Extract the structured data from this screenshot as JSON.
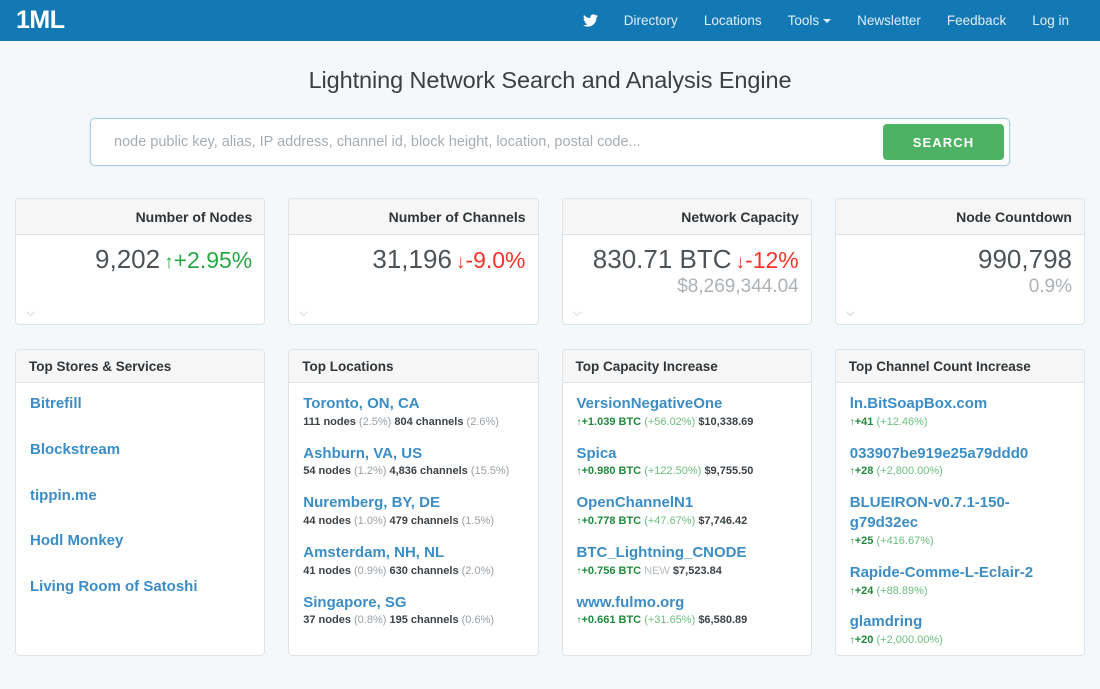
{
  "navbar": {
    "brand": "1ML",
    "twitter_icon": "twitter-icon",
    "links": [
      {
        "label": "Directory",
        "name": "directory"
      },
      {
        "label": "Locations",
        "name": "locations"
      },
      {
        "label": "Tools",
        "name": "tools",
        "caret": true
      },
      {
        "label": "Newsletter",
        "name": "newsletter"
      },
      {
        "label": "Feedback",
        "name": "feedback"
      },
      {
        "label": "Log in",
        "name": "login"
      }
    ]
  },
  "hero": {
    "title": "Lightning Network Search and Analysis Engine",
    "search_placeholder": "node public key, alias, IP address, channel id, block height, location, postal code...",
    "search_value": "",
    "search_button": "SEARCH"
  },
  "colors": {
    "navbar_blue": "#1279b5",
    "search_green": "#4eb264",
    "link_blue": "#3c8dc5",
    "up_green": "#29a745",
    "down_red": "#f6342a",
    "page_bg": "#f4f8fb"
  },
  "stats": [
    {
      "title": "Number of Nodes",
      "value": "9,202",
      "delta": "+2.95%",
      "direction": "up",
      "arrow": "↑",
      "sub": "",
      "chevron": "chevron-down-icon"
    },
    {
      "title": "Number of Channels",
      "value": "31,196",
      "delta": "-9.0%",
      "direction": "down",
      "arrow": "↓",
      "sub": "",
      "chevron": "chevron-down-icon"
    },
    {
      "title": "Network Capacity",
      "value": "830.71 BTC",
      "delta": "-12%",
      "direction": "down",
      "arrow": "↓",
      "sub": "$8,269,344.04",
      "chevron": "chevron-down-icon"
    },
    {
      "title": "Node Countdown",
      "value": "990,798",
      "delta": "",
      "direction": "none",
      "arrow": "",
      "sub": "0.9%",
      "chevron": "chevron-down-icon"
    }
  ],
  "panels": {
    "stores": {
      "title": "Top Stores & Services",
      "items": [
        {
          "name": "Bitrefill"
        },
        {
          "name": "Blockstream"
        },
        {
          "name": "tippin.me"
        },
        {
          "name": "Hodl Monkey"
        },
        {
          "name": "Living Room of Satoshi"
        }
      ]
    },
    "locations": {
      "title": "Top Locations",
      "items": [
        {
          "name": "Toronto, ON, CA",
          "nodes": "111 nodes",
          "nodes_pct": "(2.5%)",
          "channels": "804 channels",
          "channels_pct": "(2.6%)"
        },
        {
          "name": "Ashburn, VA, US",
          "nodes": "54 nodes",
          "nodes_pct": "(1.2%)",
          "channels": "4,836 channels",
          "channels_pct": "(15.5%)"
        },
        {
          "name": "Nuremberg, BY, DE",
          "nodes": "44 nodes",
          "nodes_pct": "(1.0%)",
          "channels": "479 channels",
          "channels_pct": "(1.5%)"
        },
        {
          "name": "Amsterdam, NH, NL",
          "nodes": "41 nodes",
          "nodes_pct": "(0.9%)",
          "channels": "630 channels",
          "channels_pct": "(2.0%)"
        },
        {
          "name": "Singapore, SG",
          "nodes": "37 nodes",
          "nodes_pct": "(0.8%)",
          "channels": "195 channels",
          "channels_pct": "(0.6%)"
        }
      ]
    },
    "capacity": {
      "title": "Top Capacity Increase",
      "items": [
        {
          "name": "VersionNegativeOne",
          "arrow": "↑",
          "amount": "+1.039 BTC",
          "pct": "(+56.02%)",
          "pct_style": "green",
          "fiat": "$10,338.69"
        },
        {
          "name": "Spica",
          "arrow": "↑",
          "amount": "+0.980 BTC",
          "pct": "(+122.50%)",
          "pct_style": "green",
          "fiat": "$9,755.50"
        },
        {
          "name": "OpenChannelN1",
          "arrow": "↑",
          "amount": "+0.778 BTC",
          "pct": "(+47.67%)",
          "pct_style": "green",
          "fiat": "$7,746.42"
        },
        {
          "name": "BTC_Lightning_CNODE",
          "arrow": "↑",
          "amount": "+0.756 BTC",
          "pct": "NEW",
          "pct_style": "gray",
          "fiat": "$7,523.84"
        },
        {
          "name": "www.fulmo.org",
          "arrow": "↑",
          "amount": "+0.661 BTC",
          "pct": "(+31.65%)",
          "pct_style": "green",
          "fiat": "$6,580.89"
        }
      ]
    },
    "channels": {
      "title": "Top Channel Count Increase",
      "items": [
        {
          "name": "ln.BitSoapBox.com",
          "arrow": "↑",
          "amount": "+41",
          "pct": "(+12.46%)"
        },
        {
          "name": "033907be919e25a79ddd0",
          "arrow": "↑",
          "amount": "+28",
          "pct": "(+2,800.00%)"
        },
        {
          "name": "BLUEIRON-v0.7.1-150-g79d32ec",
          "arrow": "↑",
          "amount": "+25",
          "pct": "(+416.67%)"
        },
        {
          "name": "Rapide-Comme-L-Eclair-2",
          "arrow": "↑",
          "amount": "+24",
          "pct": "(+88.89%)"
        },
        {
          "name": "glamdring",
          "arrow": "↑",
          "amount": "+20",
          "pct": "(+2,000.00%)"
        }
      ]
    }
  }
}
